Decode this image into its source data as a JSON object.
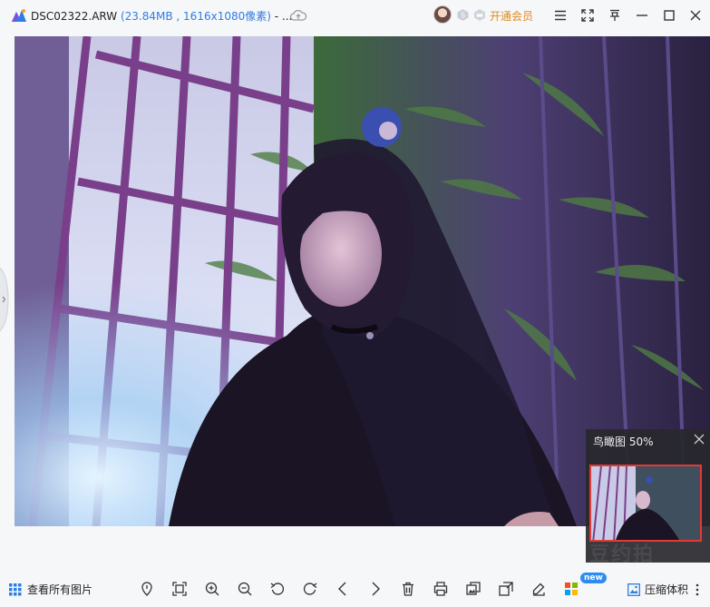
{
  "titlebar": {
    "filename": "DSC02322.ARW",
    "file_info": "(23.84MB , 1616x1080像素)",
    "ellipsis": "- ...",
    "vip_label": "开通会员"
  },
  "navigator": {
    "title": "鸟瞰图",
    "zoom": "50%"
  },
  "watermark": "豆约拍",
  "bottombar": {
    "view_all_label": "查看所有图片",
    "new_badge": "new",
    "compress_label": "压缩体积"
  },
  "icons": {
    "app": "app-logo-icon",
    "cloud": "cloud-upload-icon",
    "menu": "menu-icon",
    "fullscreen": "fullscreen-icon",
    "pin": "pin-icon",
    "minimize": "minimize-icon",
    "maximize": "maximize-icon",
    "close": "close-icon"
  },
  "colors": {
    "accent_blue": "#2f7de1",
    "vip_orange": "#e08a1c",
    "new_badge": "#2f8bf0"
  }
}
